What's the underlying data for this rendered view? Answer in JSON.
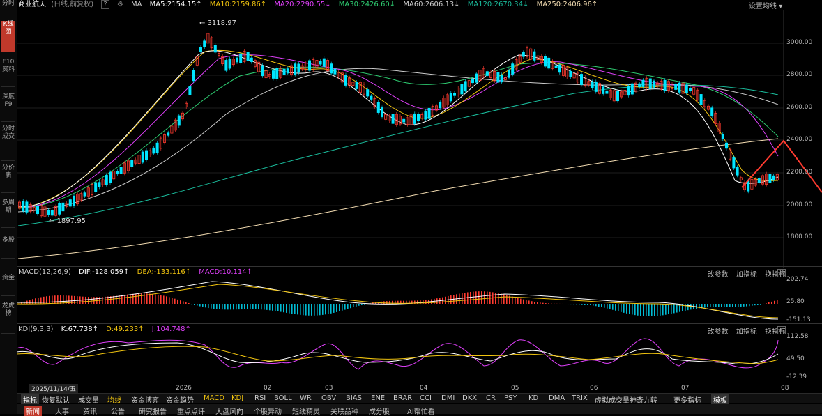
{
  "sidebar": {
    "tabs": [
      {
        "label": "分时",
        "active": false
      },
      {
        "label": "K线图",
        "active": true
      },
      {
        "label": "F10资料",
        "active": false
      },
      {
        "label": "深度F9",
        "active": false
      },
      {
        "label": "分时成交",
        "active": false
      },
      {
        "label": "分价表",
        "active": false
      },
      {
        "label": "多周期",
        "active": false
      },
      {
        "label": "多股",
        "active": false
      },
      {
        "label": "资金",
        "active": false
      },
      {
        "label": "龙虎榜",
        "active": false
      }
    ]
  },
  "header": {
    "stock_name": "商业航天",
    "mode": "(日线,前复权)",
    "help_icon": "?",
    "ma_label": "MA",
    "ma": [
      {
        "text": "MA5:2154.15↑",
        "color": "#ffffff"
      },
      {
        "text": "MA10:2159.86↑",
        "color": "#f1c40f"
      },
      {
        "text": "MA20:2290.55↓",
        "color": "#e040fb"
      },
      {
        "text": "MA30:2426.60↓",
        "color": "#2ecc71"
      },
      {
        "text": "MA60:2606.13↓",
        "color": "#cccccc"
      },
      {
        "text": "MA120:2670.34↓",
        "color": "#1abc9c"
      },
      {
        "text": "MA250:2406.96↑",
        "color": "#f5deb3"
      }
    ],
    "settings": "设置均线"
  },
  "main_chart": {
    "high_label": "3118.97",
    "low_label": "1897.95",
    "y_ticks": [
      "3000.00",
      "2800.00",
      "2600.00",
      "2400.00",
      "2200.00",
      "2000.00",
      "1800.00"
    ]
  },
  "macd": {
    "title": "MACD(12,26,9)",
    "dif": "DIF:-128.059↑",
    "dea": "DEA:-133.116↑",
    "macd": "MACD:10.114↑",
    "actions": [
      "改参数",
      "加指标",
      "换指标"
    ],
    "y_ticks": [
      "202.74",
      "25.80",
      "-151.13"
    ]
  },
  "kdj": {
    "title": "KDJ(9,3,3)",
    "k": "K:67.738↑",
    "d": "D:49.233↑",
    "j": "J:104.748↑",
    "actions": [
      "改参数",
      "加指标",
      "换指标"
    ],
    "y_ticks": [
      "112.58",
      "49.50",
      "-12.39"
    ]
  },
  "xaxis": {
    "cursor_date": "2025/11/14/五",
    "labels": [
      "2026",
      "02",
      "03",
      "04",
      "05",
      "06",
      "07",
      "08"
    ]
  },
  "indicator_tabs": [
    "指标",
    "恢复默认",
    "成交量",
    "均线",
    "资金博弈",
    "资金趋势",
    "MACD",
    "KDJ",
    "RSI",
    "BOLL",
    "WR",
    "OBV",
    "BIAS",
    "ENE",
    "BRAR",
    "CCI",
    "DMI",
    "DKX",
    "CR",
    "PSY",
    "KD",
    "DMA",
    "TRIX",
    "虚拟成交量",
    "神奇九转",
    "更多指标",
    "模板"
  ],
  "bottom_tabs": [
    "新闻",
    "大事",
    "资讯",
    "公告",
    "研究报告",
    "重点点评",
    "大盘风向",
    "个股异动",
    "短线精灵",
    "关联品种",
    "成分股",
    "AI帮忙看"
  ]
}
